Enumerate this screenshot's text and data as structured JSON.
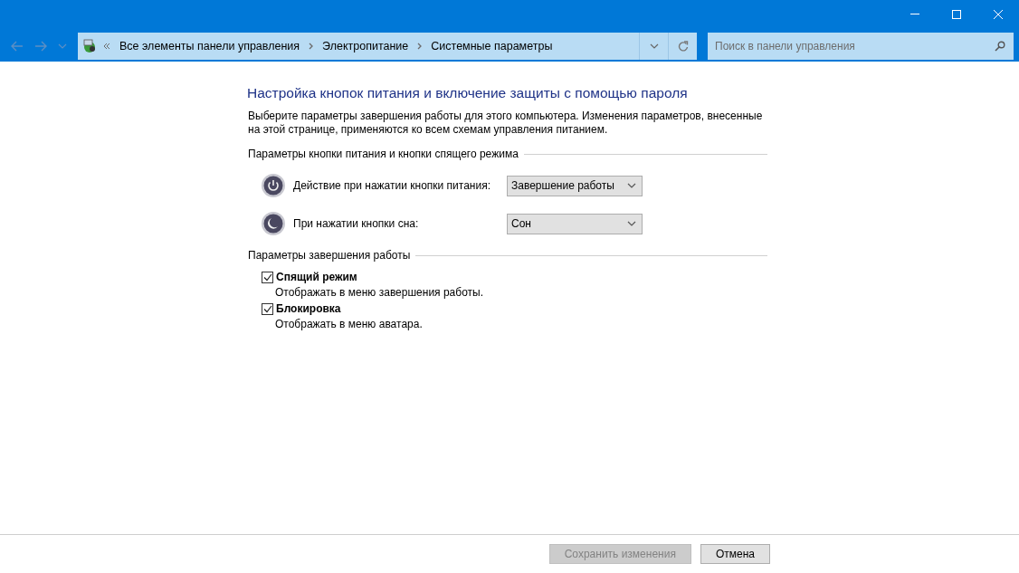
{
  "address_bar": {
    "breadcrumbs": [
      "Все элементы панели управления",
      "Электропитание",
      "Системные параметры"
    ]
  },
  "search": {
    "placeholder": "Поиск в панели управления"
  },
  "heading": "Настройка кнопок питания и включение защиты с помощью пароля",
  "description": "Выберите параметры завершения работы для этого компьютера. Изменения параметров, внесенные на этой странице, применяются ко всем схемам управления питанием.",
  "button_section": {
    "title": "Параметры кнопки питания и кнопки спящего режима",
    "rows": [
      {
        "kind": "power",
        "label": "Действие при нажатии кнопки питания:",
        "value": "Завершение работы"
      },
      {
        "kind": "sleep",
        "label": "При нажатии кнопки сна:",
        "value": "Сон"
      }
    ]
  },
  "shutdown_section": {
    "title": "Параметры завершения работы",
    "options": [
      {
        "label": "Спящий режим",
        "description": "Отображать в меню завершения работы.",
        "checked": true
      },
      {
        "label": "Блокировка",
        "description": "Отображать в меню аватара.",
        "checked": true
      }
    ]
  },
  "buttons": [
    {
      "label": "Сохранить изменения",
      "disabled": true
    },
    {
      "label": "Отмена",
      "disabled": false
    }
  ]
}
